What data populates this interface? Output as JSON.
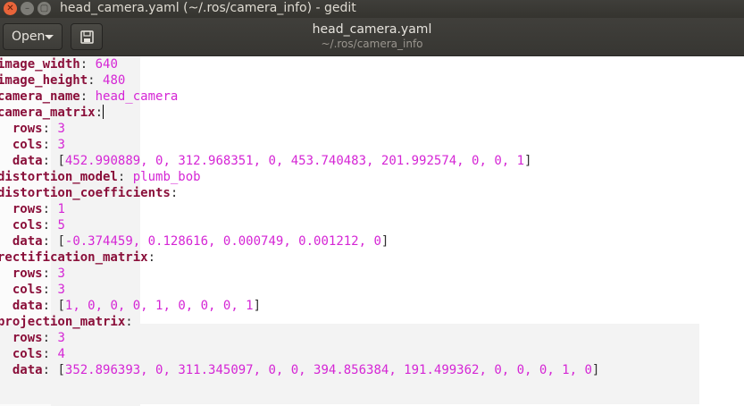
{
  "window": {
    "title": "head_camera.yaml (~/.ros/camera_info) - gedit"
  },
  "toolbar": {
    "open_label": "Open"
  },
  "header": {
    "title": "head_camera.yaml",
    "subtitle": "~/.ros/camera_info"
  },
  "editor": {
    "lines": [
      {
        "indent": "",
        "key": "image_width",
        "value": "640"
      },
      {
        "indent": "",
        "key": "image_height",
        "value": "480"
      },
      {
        "indent": "",
        "key": "camera_name",
        "value": "head_camera"
      },
      {
        "indent": "",
        "key": "camera_matrix",
        "value": ""
      },
      {
        "indent": "  ",
        "key": "rows",
        "value": "3"
      },
      {
        "indent": "  ",
        "key": "cols",
        "value": "3"
      },
      {
        "indent": "  ",
        "key": "data",
        "value": "452.990889, 0, 312.968351, 0, 453.740483, 201.992574, 0, 0, 1"
      },
      {
        "indent": "",
        "key": "distortion_model",
        "value": "plumb_bob"
      },
      {
        "indent": "",
        "key": "distortion_coefficients",
        "value": ""
      },
      {
        "indent": "  ",
        "key": "rows",
        "value": "1"
      },
      {
        "indent": "  ",
        "key": "cols",
        "value": "5"
      },
      {
        "indent": "  ",
        "key": "data",
        "value": "-0.374459, 0.128616, 0.000749, 0.001212, 0"
      },
      {
        "indent": "",
        "key": "rectification_matrix",
        "value": ""
      },
      {
        "indent": "  ",
        "key": "rows",
        "value": "3"
      },
      {
        "indent": "  ",
        "key": "cols",
        "value": "3"
      },
      {
        "indent": "  ",
        "key": "data",
        "value": "1, 0, 0, 0, 1, 0, 0, 0, 1"
      },
      {
        "indent": "",
        "key": "projection_matrix",
        "value": ""
      },
      {
        "indent": "  ",
        "key": "rows",
        "value": "3"
      },
      {
        "indent": "  ",
        "key": "cols",
        "value": "4"
      },
      {
        "indent": "  ",
        "key": "data",
        "value": "352.896393, 0, 311.345097, 0, 0, 394.856384, 191.499362, 0, 0, 0, 1, 0"
      }
    ]
  },
  "colors": {
    "key": "#8a0f3a",
    "value": "#d526d5",
    "titlebar": "#3c3b37",
    "close_button": "#e8643a"
  }
}
